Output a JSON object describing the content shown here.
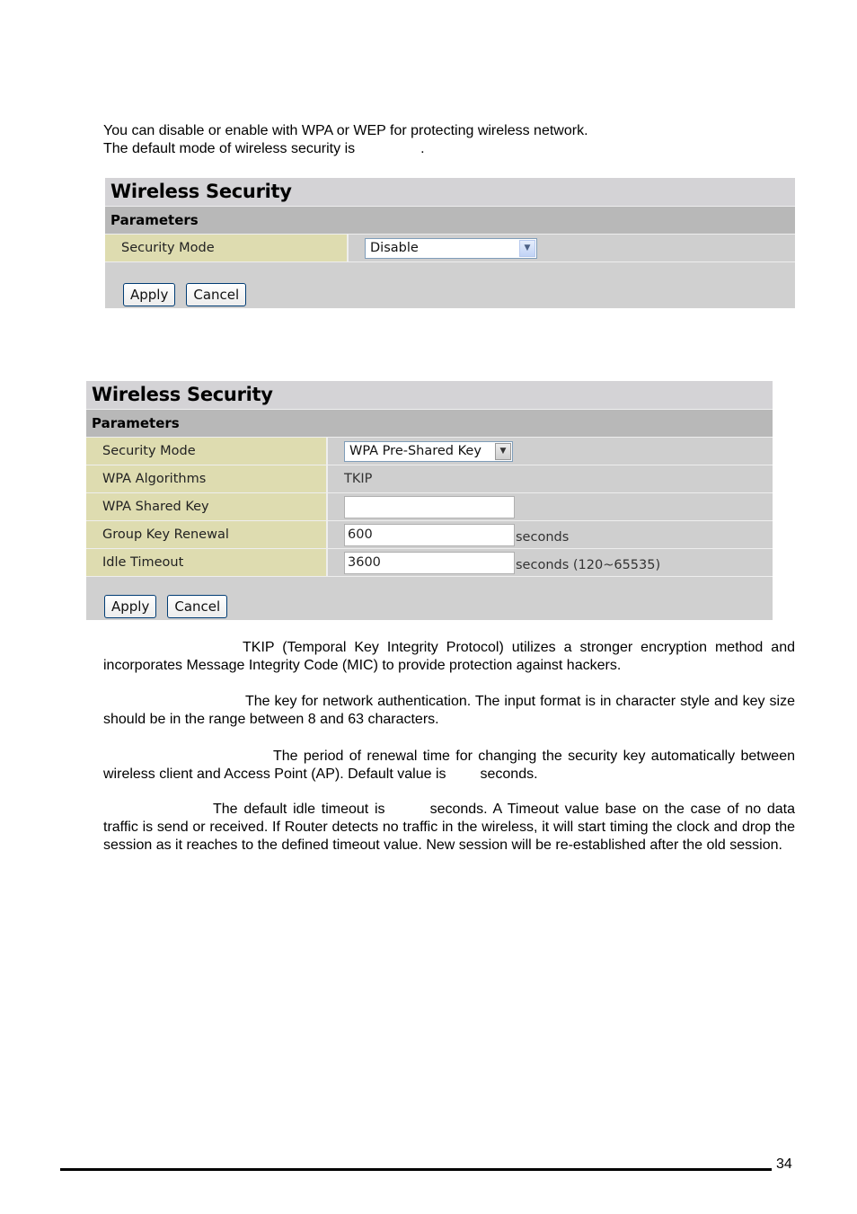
{
  "intro": {
    "line1": "You can disable or enable with WPA or WEP for protecting wireless network.",
    "line2_before": "The default mode of wireless security is",
    "line2_after": "."
  },
  "panel1": {
    "title": "Wireless Security",
    "subtitle": "Parameters",
    "rows": [
      {
        "label": "Security Mode",
        "select_value": "Disable"
      }
    ],
    "apply_label": "Apply",
    "cancel_label": "Cancel"
  },
  "panel2": {
    "title": "Wireless Security",
    "subtitle": "Parameters",
    "security_mode": {
      "label": "Security Mode",
      "value": "WPA Pre-Shared Key"
    },
    "wpa_algorithms": {
      "label": "WPA Algorithms",
      "value": "TKIP"
    },
    "wpa_shared_key": {
      "label": "WPA Shared Key",
      "value": ""
    },
    "group_key_renewal": {
      "label": "Group Key Renewal",
      "value": "600",
      "unit": "seconds"
    },
    "idle_timeout": {
      "label": "Idle Timeout",
      "value": "3600",
      "unit": "seconds (120~65535)"
    },
    "apply_label": "Apply",
    "cancel_label": "Cancel"
  },
  "descriptions": {
    "wpa_algorithms": "TKIP (Temporal Key Integrity Protocol) utilizes a stronger encryption method and incorporates Message Integrity Code (MIC) to provide protection against hackers.",
    "wpa_shared_key": "The key for network authentication. The input format is in character style and key size should be in the range between 8 and 63 characters.",
    "group_key_renewal_before": "The period of renewal time for changing the security key automatically between wireless client and Access Point (AP).  Default value is",
    "group_key_renewal_after": "seconds.",
    "idle_timeout_before": "The default idle timeout is",
    "idle_timeout_after": "seconds.  A Timeout value base on the case of no data traffic is send or received. If Router detects no traffic in the wireless, it will start timing the clock and drop the session as it reaches to the defined timeout value. New session will be re-established after the old session."
  },
  "footer": {
    "page_number": "34"
  }
}
